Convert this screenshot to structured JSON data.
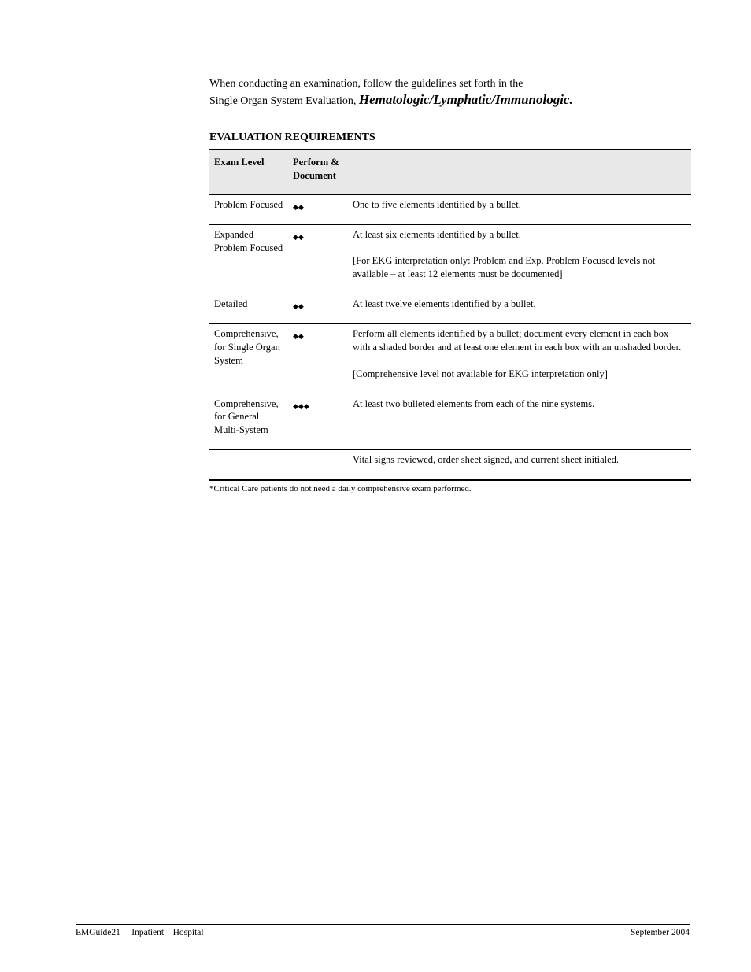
{
  "intro": {
    "line1": "When conducting an examination, follow the guidelines set forth in the",
    "line2a": "Single Organ System Evaluation, ",
    "line2b": "Hematologic/Lymphatic/Immunologic."
  },
  "tableTitle": "EVALUATION REQUIREMENTS",
  "columns": {
    "c1": "Exam Level",
    "c2": "Perform & Document"
  },
  "diamondGlyph": "◆",
  "rows": [
    {
      "level": "Problem Focused",
      "diamonds": 2,
      "req": "One to five elements identified by a bullet."
    },
    {
      "level": "Expanded Problem Focused",
      "diamonds": 2,
      "req": "At least six elements identified by a bullet.",
      "extra": "[For EKG interpretation only: Problem and Exp. Problem Focused levels not available – at least 12 elements must be documented]"
    },
    {
      "level": "Detailed",
      "diamonds": 2,
      "req": "At least twelve elements identified by a bullet."
    },
    {
      "level": "Comprehensive, for Single Organ System",
      "diamonds": 2,
      "req": "Perform all elements identified by a bullet; document every element in each box with a shaded border and at least one element in each box with an unshaded border.",
      "extra": "[Comprehensive level not available for EKG interpretation only]"
    },
    {
      "level": "Comprehensive, for General Multi-System",
      "diamonds": 3,
      "req": "At least two bulleted elements from each of the nine systems."
    },
    {
      "level": "",
      "diamonds": 0,
      "req": "Vital signs reviewed, order sheet signed, and current sheet initialed."
    }
  ],
  "footnote": "*Critical Care patients do not need a daily comprehensive exam performed.",
  "footer": {
    "leftCode": "EMGuide21",
    "leftLabel": "Inpatient – Hospital",
    "right": "September 2004"
  }
}
